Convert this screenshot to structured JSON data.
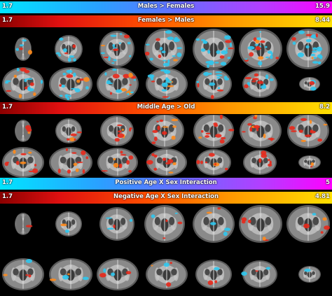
{
  "colorbars": [
    {
      "id": "males-females",
      "min": "1.7",
      "title": "Males > Females",
      "max": "15.9",
      "scheme": "blue"
    },
    {
      "id": "females-males",
      "min": "1.7",
      "title": "Females > Males",
      "max": "8.44",
      "scheme": "red"
    },
    {
      "id": "middle-old",
      "min": "1.7",
      "title": "Middle Age > Old",
      "max": "8.2",
      "scheme": "red"
    },
    {
      "id": "pos-interaction",
      "min": "1.7",
      "title": "Positive Age X Sex Interaction",
      "max": "5",
      "scheme": "blue"
    },
    {
      "id": "neg-interaction",
      "min": "1.7",
      "title": "Negative Age X Sex Interaction",
      "max": "4.81",
      "scheme": "red"
    }
  ],
  "colors": {
    "blue_overlay": "#2ec8f0",
    "red_overlay": "#e8281a",
    "orange_overlay": "#ff8a1a",
    "tissue_light": "#c8c8c8",
    "tissue_dark": "#3a3a3a",
    "background": "#000000"
  },
  "panels": [
    {
      "id": "sex-panel",
      "overlays": [
        "blue",
        "red"
      ]
    },
    {
      "id": "age-panel",
      "overlays": [
        "red"
      ]
    },
    {
      "id": "interaction-panel",
      "overlays": [
        "blue",
        "red"
      ]
    }
  ]
}
